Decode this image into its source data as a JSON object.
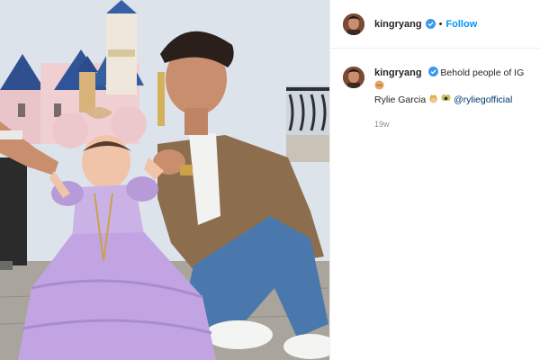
{
  "post": {
    "username": "kingryang",
    "follow_label": "Follow",
    "separator": "•",
    "caption_text": "Behold people of IG",
    "caption_name": "Rylie Garcia",
    "caption_mention": "@ryliegofficial",
    "time_ago": "19w",
    "emojis": [
      "pointing-hand-emoji",
      "princess-emoji",
      "fairy-emoji"
    ]
  },
  "colors": {
    "follow_blue": "#0095f6",
    "mention_blue": "#00376b",
    "verified_blue": "#3897f0",
    "timestamp_gray": "#8e8e8e"
  }
}
